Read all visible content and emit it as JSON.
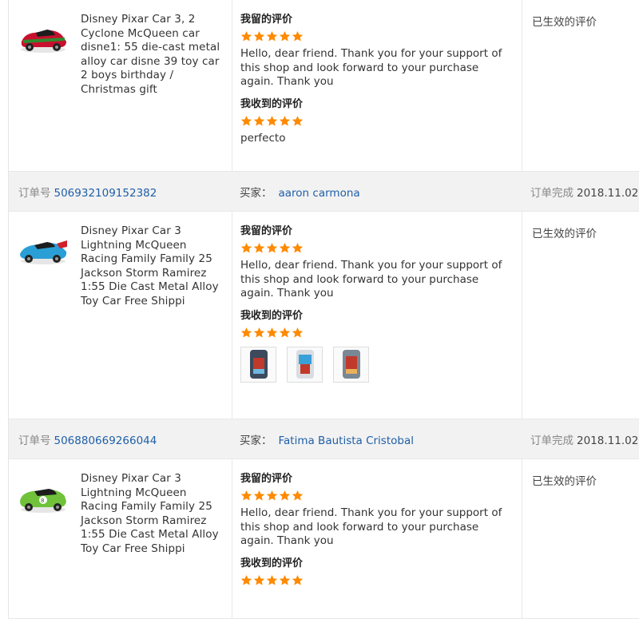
{
  "reviews": [
    {
      "product_title": "Disney Pixar Car 3, 2 Cyclone McQueen car disne1: 55 die-cast metal alloy car disne 39 toy car 2 boys birthday / Christmas gift",
      "car_color": "#c8102e",
      "car_accent": "#2e8b2e",
      "left_label": "我留的评价",
      "left_rating": 5,
      "left_text": "Hello, dear friend. Thank you for your support of this shop and look forward to your purchase again. Thank you",
      "received_label": "我收到的评价",
      "received_rating": 5,
      "received_text": "perfecto",
      "status": "已生效的评价"
    },
    {
      "order_label": "订单号",
      "order_number": "506932109152382",
      "buyer_label": "买家：",
      "buyer_name": "aaron carmona",
      "completed_label": "订单完成",
      "completed_date": "2018.11.02",
      "product_title": "Disney Pixar Car 3 Lightning McQueen Racing Family Family 25 Jackson Storm Ramirez 1:55 Die Cast Metal Alloy Toy Car Free Shippi",
      "car_color": "#2a9fd6",
      "car_accent": "#d0202a",
      "left_label": "我留的评价",
      "left_rating": 5,
      "left_text": "Hello, dear friend. Thank you for your support of this shop and look forward to your purchase again. Thank you",
      "received_label": "我收到的评价",
      "received_rating": 5,
      "photos": [
        "photo-1",
        "photo-2",
        "photo-3"
      ],
      "status": "已生效的评价"
    },
    {
      "order_label": "订单号",
      "order_number": "506880669266044",
      "buyer_label": "买家：",
      "buyer_name": "Fatima Bautista Cristobal",
      "completed_label": "订单完成",
      "completed_date": "2018.11.02",
      "product_title": "Disney Pixar Car 3 Lightning McQueen Racing Family Family 25 Jackson Storm Ramirez 1:55 Die Cast Metal Alloy Toy Car Free Shippi",
      "car_color": "#6fc23a",
      "car_accent": "#2b6e1a",
      "left_label": "我留的评价",
      "left_rating": 5,
      "left_text": "Hello, dear friend. Thank you for your support of this shop and look forward to your purchase again. Thank you",
      "received_label": "我收到的评价",
      "received_rating": 5,
      "status": "已生效的评价"
    }
  ],
  "colors": {
    "star": "#ff8a00",
    "link": "#1f5fa8",
    "bar_bg": "#f2f2f2"
  }
}
